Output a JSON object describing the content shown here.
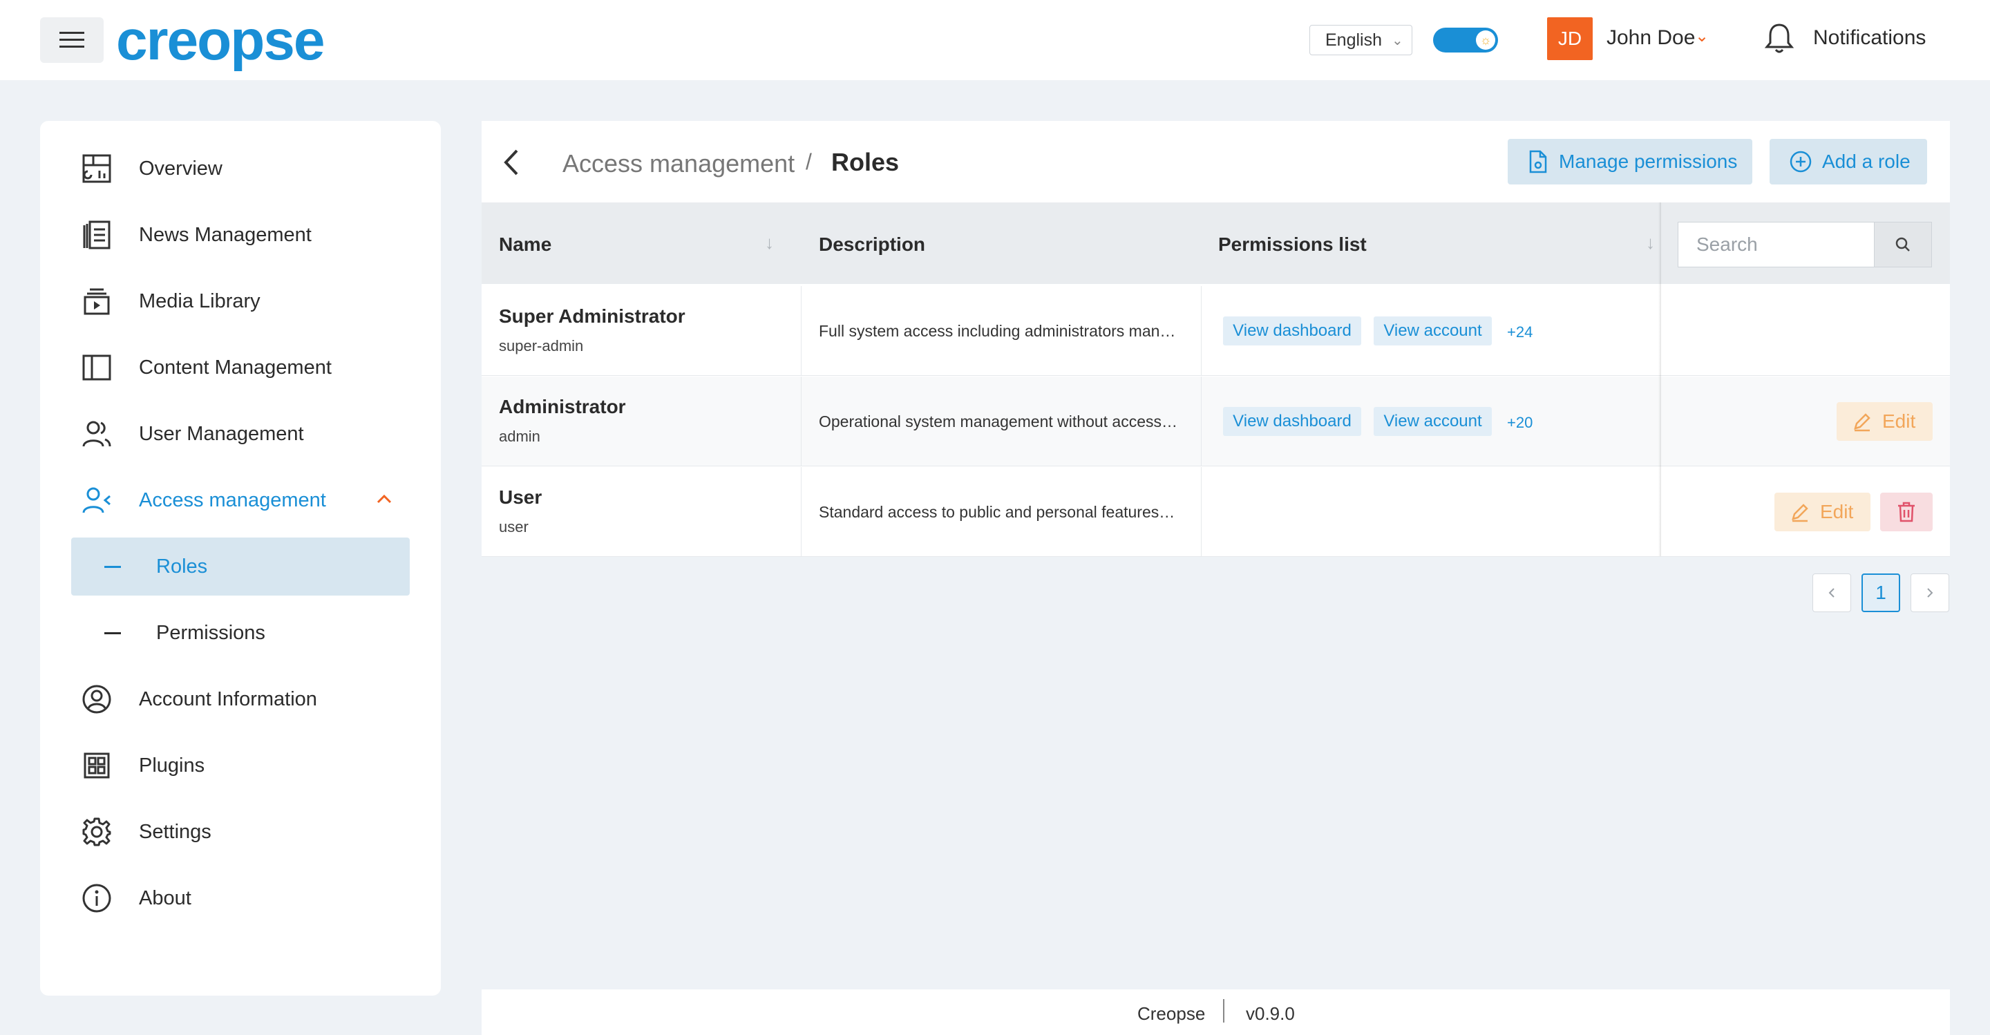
{
  "header": {
    "logo_text": "creopse",
    "language": "English",
    "user_initials": "JD",
    "user_name": "John Doe",
    "notifications_label": "Notifications"
  },
  "sidebar": {
    "items": [
      {
        "label": "Overview",
        "icon": "dashboard-icon"
      },
      {
        "label": "News Management",
        "icon": "news-icon"
      },
      {
        "label": "Media Library",
        "icon": "media-icon"
      },
      {
        "label": "Content Management",
        "icon": "layout-icon"
      },
      {
        "label": "User Management",
        "icon": "users-icon"
      },
      {
        "label": "Access management",
        "icon": "user-access-icon",
        "expanded": true
      },
      {
        "label": "Account Information",
        "icon": "account-circle-icon"
      },
      {
        "label": "Plugins",
        "icon": "plugins-icon"
      },
      {
        "label": "Settings",
        "icon": "gear-icon"
      },
      {
        "label": "About",
        "icon": "info-icon"
      }
    ],
    "sub_items": [
      {
        "label": "Roles",
        "active": true
      },
      {
        "label": "Permissions",
        "active": false
      }
    ]
  },
  "page": {
    "breadcrumb_parent": "Access management",
    "breadcrumb_sep": "/",
    "breadcrumb_current": "Roles",
    "manage_permissions_label": "Manage permissions",
    "add_role_label": "Add a role"
  },
  "table": {
    "columns": [
      "Name",
      "Description",
      "Permissions list"
    ],
    "search_placeholder": "Search",
    "edit_label": "Edit",
    "rows": [
      {
        "name": "Super Administrator",
        "slug": "super-admin",
        "description": "Full system access including administrators management and settings",
        "permissions": [
          "View dashboard",
          "View account"
        ],
        "more": "+24"
      },
      {
        "name": "Administrator",
        "slug": "admin",
        "description": "Operational system management without access to critical settings",
        "permissions": [
          "View dashboard",
          "View account"
        ],
        "more": "+20"
      },
      {
        "name": "User",
        "slug": "user",
        "description": "Standard access to public and personal features of the platform",
        "permissions": [],
        "more": ""
      }
    ]
  },
  "pagination": {
    "current_page": "1"
  },
  "footer": {
    "app_name": "Creopse",
    "version": "v0.9.0"
  },
  "colors": {
    "accent": "#1a8fd6",
    "brand_orange": "#f26422",
    "edit": "#f2a65a",
    "delete": "#e0526a"
  }
}
